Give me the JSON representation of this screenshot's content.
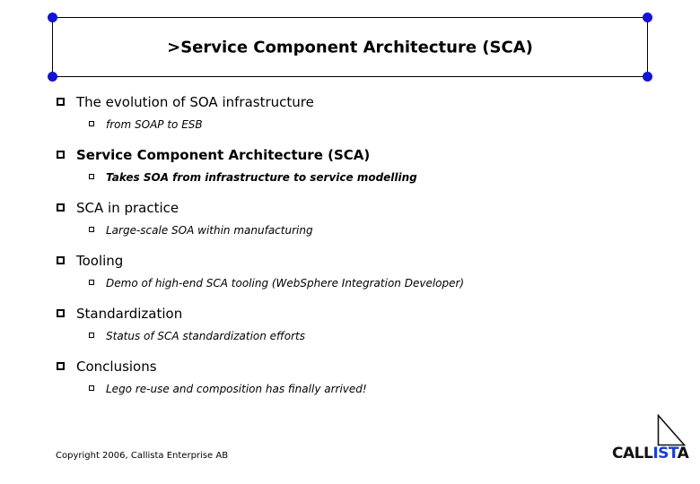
{
  "slide": {
    "title": ">Service Component Architecture (SCA)",
    "selection_handle_color": "#1414d2",
    "bullets": [
      {
        "label": "The evolution of SOA infrastructure",
        "bold": false,
        "sub": "from SOAP to ESB",
        "sub_bold": false
      },
      {
        "label": "Service Component Architecture (SCA)",
        "bold": true,
        "sub": "Takes SOA from infrastructure to service modelling",
        "sub_bold": true
      },
      {
        "label": "SCA in practice",
        "bold": false,
        "sub": "Large-scale SOA within manufacturing",
        "sub_bold": false
      },
      {
        "label": "Tooling",
        "bold": false,
        "sub": "Demo of high-end SCA tooling (WebSphere Integration Developer)",
        "sub_bold": false
      },
      {
        "label": "Standardization",
        "bold": false,
        "sub": "Status of SCA standardization efforts",
        "sub_bold": false
      },
      {
        "label": "Conclusions",
        "bold": false,
        "sub": "Lego re-use and composition has finally arrived!",
        "sub_bold": false
      }
    ],
    "footer": {
      "copyright": "Copyright 2006, Callista Enterprise AB"
    },
    "logo": {
      "word_dark_1": "CALL",
      "word_accent": "IST",
      "word_dark_2": "A",
      "accent_color": "#1a3fd0"
    }
  }
}
